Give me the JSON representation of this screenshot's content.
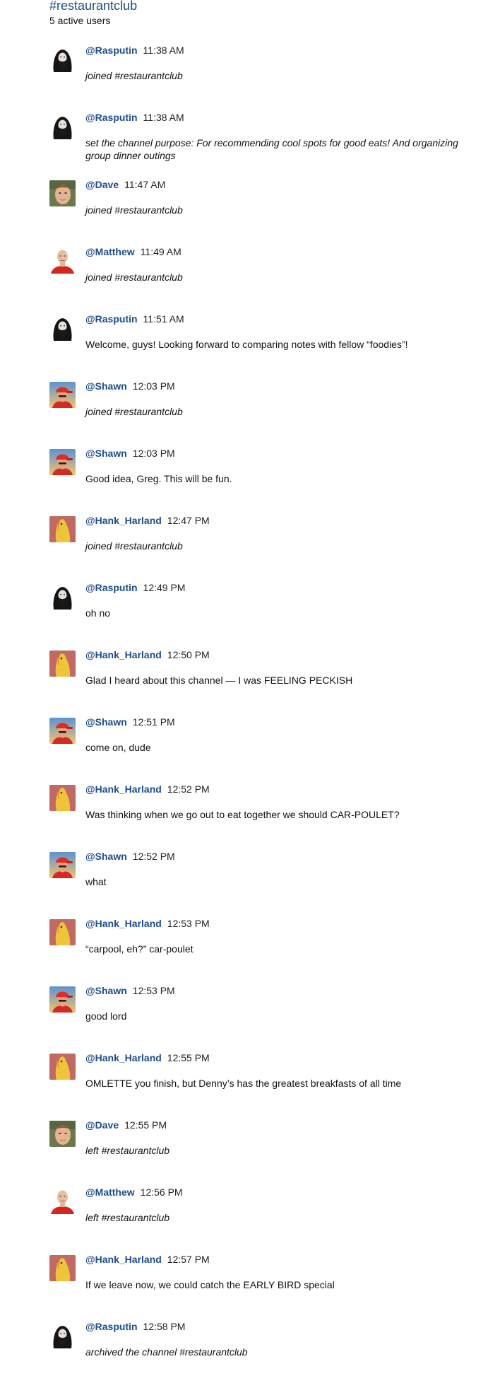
{
  "channel": {
    "title": "#restaurantclub",
    "active_users": "5 active users"
  },
  "messages": [
    {
      "user": "@Rasputin",
      "time": "11:38 AM",
      "text": "joined #restaurantclub",
      "kind": "system",
      "avatar": "rasputin-avatar-icon"
    },
    {
      "user": "@Rasputin",
      "time": "11:38 AM",
      "text": "set the channel purpose: For recommending cool spots for good eats! And organizing group dinner outings",
      "kind": "system",
      "avatar": "rasputin-avatar-icon"
    },
    {
      "user": "@Dave",
      "time": "11:47 AM",
      "text": "joined #restaurantclub",
      "kind": "system",
      "avatar": "dave-avatar-icon"
    },
    {
      "user": "@Matthew",
      "time": "11:49 AM",
      "text": "joined #restaurantclub",
      "kind": "system",
      "avatar": "matthew-avatar-icon"
    },
    {
      "user": "@Rasputin",
      "time": "11:51 AM",
      "text": "Welcome, guys! Looking forward to comparing notes with fellow “foodies”!",
      "kind": "text",
      "avatar": "rasputin-avatar-icon"
    },
    {
      "user": "@Shawn",
      "time": "12:03 PM",
      "text": "joined #restaurantclub",
      "kind": "system",
      "avatar": "shawn-avatar-icon"
    },
    {
      "user": "@Shawn",
      "time": "12:03 PM",
      "text": "Good idea, Greg. This will be fun.",
      "kind": "text",
      "avatar": "shawn-avatar-icon"
    },
    {
      "user": "@Hank_Harland",
      "time": "12:47 PM",
      "text": "joined #restaurantclub",
      "kind": "system",
      "avatar": "hank-avatar-icon"
    },
    {
      "user": "@Rasputin",
      "time": "12:49 PM",
      "text": "oh no",
      "kind": "text",
      "avatar": "rasputin-avatar-icon"
    },
    {
      "user": "@Hank_Harland",
      "time": "12:50 PM",
      "text": "Glad I heard about this channel — I was FEELING PECKISH",
      "kind": "text",
      "avatar": "hank-avatar-icon"
    },
    {
      "user": "@Shawn",
      "time": "12:51 PM",
      "text": "come on, dude",
      "kind": "text",
      "avatar": "shawn-avatar-icon"
    },
    {
      "user": "@Hank_Harland",
      "time": "12:52 PM",
      "text": "Was thinking when we go out to eat together we should CAR-POULET?",
      "kind": "text",
      "avatar": "hank-avatar-icon"
    },
    {
      "user": "@Shawn",
      "time": "12:52 PM",
      "text": "what",
      "kind": "text",
      "avatar": "shawn-avatar-icon"
    },
    {
      "user": "@Hank_Harland",
      "time": "12:53 PM",
      "text": "“carpool, eh?” car-poulet",
      "kind": "text",
      "avatar": "hank-avatar-icon"
    },
    {
      "user": "@Shawn",
      "time": "12:53 PM",
      "text": "good lord",
      "kind": "text",
      "avatar": "shawn-avatar-icon"
    },
    {
      "user": "@Hank_Harland",
      "time": "12:55 PM",
      "text": "OMLETTE you finish, but Denny’s has the greatest breakfasts of all time",
      "kind": "text",
      "avatar": "hank-avatar-icon"
    },
    {
      "user": "@Dave",
      "time": "12:55 PM",
      "text": "left #restaurantclub",
      "kind": "system",
      "avatar": "dave-avatar-icon"
    },
    {
      "user": "@Matthew",
      "time": "12:56 PM",
      "text": "left #restaurantclub",
      "kind": "system",
      "avatar": "matthew-avatar-icon"
    },
    {
      "user": "@Hank_Harland",
      "time": "12:57 PM",
      "text": "If we leave now, we could catch the EARLY BIRD special",
      "kind": "text",
      "avatar": "hank-avatar-icon"
    },
    {
      "user": "@Rasputin",
      "time": "12:58 PM",
      "text": "archived the channel #restaurantclub",
      "kind": "system",
      "avatar": "rasputin-avatar-icon"
    }
  ],
  "colors": {
    "username": "#1d4c8c",
    "title": "#1d4c8c",
    "text": "#111111"
  }
}
